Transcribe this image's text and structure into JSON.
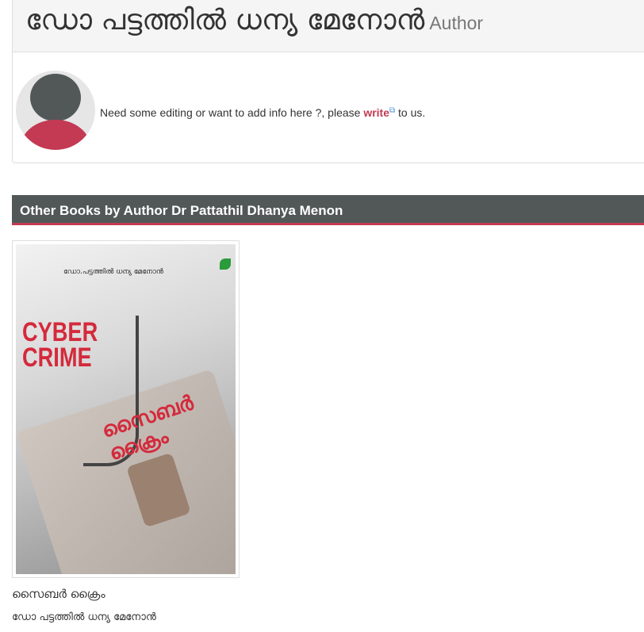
{
  "header": {
    "title": "ഡോ പട്ടത്തിൽ ധന്യ മേനോൻ",
    "subtitle": "Author"
  },
  "note": {
    "before": "Need some editing or want to add info here ?, please ",
    "link": "write",
    "after": " to us."
  },
  "section": {
    "title": "Other Books by Author Dr Pattathil Dhanya Menon"
  },
  "books": [
    {
      "title": "സൈബർ ക്രൈം",
      "author": "ഡോ പട്ടത്തിൽ ധന്യ മേനോൻ",
      "cover": {
        "author": "ഡോ.പട്ടത്തിൽ ധന്യ മേനോൻ",
        "title_en": "CYBER CRIME",
        "title_ml": "സൈബർ ക്രൈം"
      }
    }
  ],
  "colors": {
    "accent": "#c33a52",
    "bar": "#525858"
  }
}
